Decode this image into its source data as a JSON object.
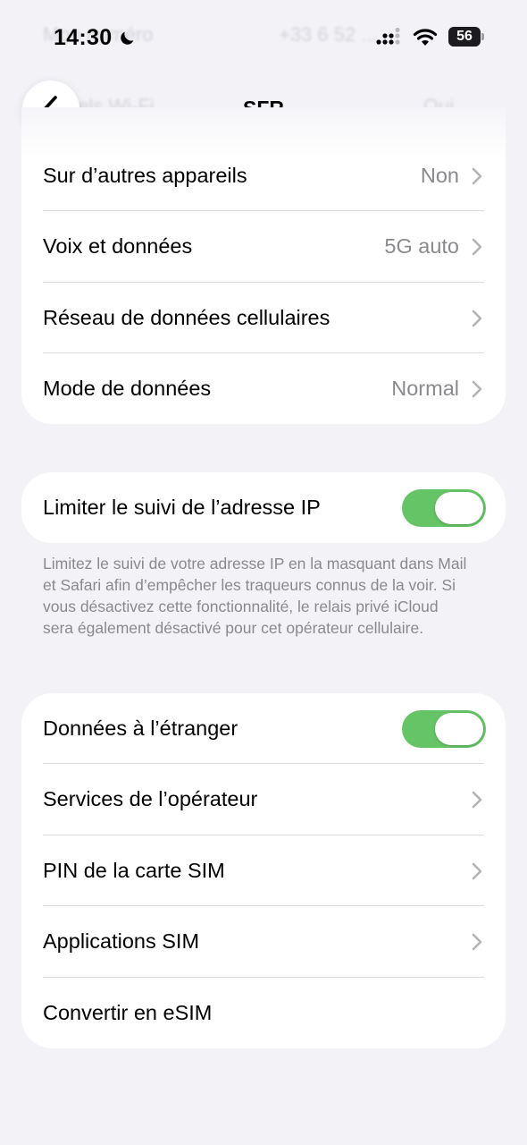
{
  "status_bar": {
    "time": "14:30",
    "battery": "56"
  },
  "background_rows": {
    "number_label": "Mon numéro",
    "number_value": "+33 6 52 ...",
    "wifi_calls_label": "Appels Wi-Fi",
    "wifi_calls_value": "Oui"
  },
  "header": {
    "title": "SFR"
  },
  "group1": {
    "rows": [
      {
        "label": "Sur d’autres appareils",
        "value": "Non"
      },
      {
        "label": "Voix et données",
        "value": "5G auto"
      },
      {
        "label": "Réseau de données cellulaires",
        "value": ""
      },
      {
        "label": "Mode de données",
        "value": "Normal"
      }
    ]
  },
  "group2": {
    "label": "Limiter le suivi de l’adresse IP",
    "toggle_on": true,
    "footnote": "Limitez le suivi de votre adresse IP en la masquant dans Mail et Safari afin d’empêcher les traqueurs connus de la voir. Si vous désactivez cette fonctionnalité, le relais privé iCloud sera également désactivé pour cet opérateur cellulaire."
  },
  "group3": {
    "roaming_label": "Données à l’étranger",
    "roaming_on": true,
    "rows": [
      {
        "label": "Services de l’opérateur"
      },
      {
        "label": "PIN de la carte SIM"
      },
      {
        "label": "Applications SIM"
      }
    ],
    "convert_label": "Convertir en eSIM"
  },
  "colors": {
    "background": "#f2f2f7",
    "toggle_on": "#65c466",
    "link": "#2f7bd8",
    "secondary_text": "#8a8a8e"
  },
  "icons": [
    "moon-icon",
    "cellular-signal-icon",
    "wifi-icon",
    "battery-icon",
    "chevron-left-icon",
    "chevron-right-icon"
  ]
}
